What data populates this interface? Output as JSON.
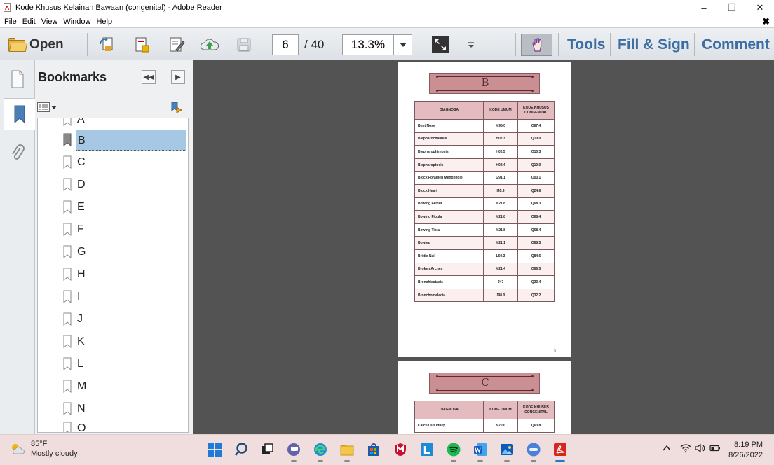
{
  "window": {
    "title": "Kode Khusus Kelainan Bawaan (congenital) - Adobe Reader",
    "controls": {
      "minimize": "–",
      "maximize": "❐",
      "close": "✕"
    }
  },
  "menu": {
    "items": [
      "File",
      "Edit",
      "View",
      "Window",
      "Help"
    ],
    "close_doc": "✖"
  },
  "toolbar": {
    "open_label": "Open",
    "page_current": "6",
    "page_total": "/ 40",
    "zoom": "13.3%",
    "tools_label": "Tools",
    "fill_sign_label": "Fill & Sign",
    "comment_label": "Comment"
  },
  "bookmarks": {
    "title": "Bookmarks",
    "items": [
      {
        "label": "A",
        "selected": false
      },
      {
        "label": "B",
        "selected": true
      },
      {
        "label": "C",
        "selected": false
      },
      {
        "label": "D",
        "selected": false
      },
      {
        "label": "E",
        "selected": false
      },
      {
        "label": "F",
        "selected": false
      },
      {
        "label": "G",
        "selected": false
      },
      {
        "label": "H",
        "selected": false
      },
      {
        "label": "I",
        "selected": false
      },
      {
        "label": "J",
        "selected": false
      },
      {
        "label": "K",
        "selected": false
      },
      {
        "label": "L",
        "selected": false
      },
      {
        "label": "M",
        "selected": false
      },
      {
        "label": "N",
        "selected": false
      },
      {
        "label": "O",
        "selected": false
      }
    ]
  },
  "document": {
    "page1": {
      "section_letter": "B",
      "page_number": "5",
      "headers": [
        "DIAGNOSA",
        "KODE UMUM",
        "KODE KHUSUS CONGENITAL"
      ],
      "rows": [
        [
          "Bent Nose",
          "M95.0",
          "Q67.4"
        ],
        [
          "Blepharochalasis",
          "H02.3",
          "Q10.0"
        ],
        [
          "Blepharophimosis",
          "H02.5",
          "Q10.3"
        ],
        [
          "Blepharoptosis",
          "H02.4",
          "Q10.0"
        ],
        [
          "Block Foramen Mengendie",
          "G91.1",
          "Q03.1"
        ],
        [
          "Block Heart",
          "I45.9",
          "Q24.6"
        ],
        [
          "Bowing Femur",
          "M21.8",
          "Q68.3"
        ],
        [
          "Bowing Fibula",
          "M21.8",
          "Q68.4"
        ],
        [
          "Bowing Tibia",
          "M21.8",
          "Q68.4"
        ],
        [
          "Bowleg",
          "M21.1",
          "Q68.5"
        ],
        [
          "Brittle Nail",
          "L60.3",
          "Q84.6"
        ],
        [
          "Broken Arches",
          "M21.4",
          "Q66.5"
        ],
        [
          "Bronchiectasis",
          "J47",
          "Q33.4"
        ],
        [
          "Bronchomalacia",
          "J98.0",
          "Q32.2"
        ]
      ]
    },
    "page2": {
      "section_letter": "C",
      "headers": [
        "DIAGNOSA",
        "KODE UMUM",
        "KODE KHUSUS CONGENITAL"
      ],
      "rows": [
        [
          "Calculus Kidney",
          "N20.0",
          "Q63.8"
        ]
      ]
    }
  },
  "taskbar": {
    "weather_temp": "85°F",
    "weather_desc": "Mostly cloudy",
    "time": "8:19 PM",
    "date": "8/26/2022"
  },
  "colors": {
    "accent_text": "#3c6ea3",
    "section_box": "#c98f92",
    "table_header": "#e4bcc0",
    "selected_bookmark": "#a7c8e4",
    "doc_background": "#535353"
  }
}
